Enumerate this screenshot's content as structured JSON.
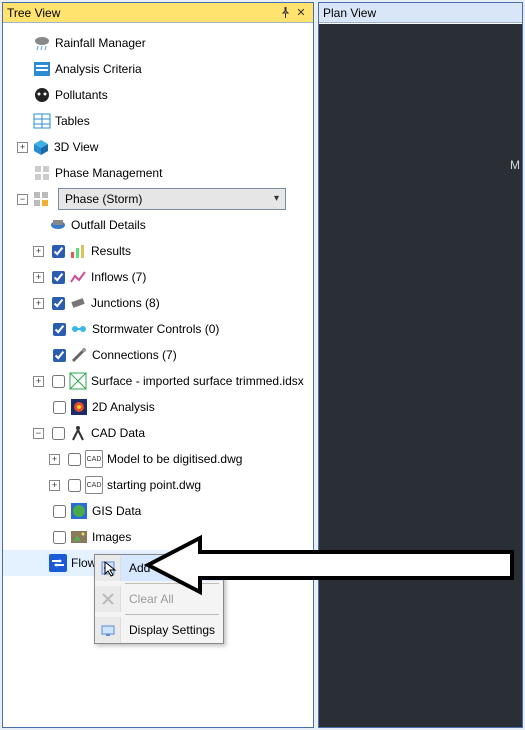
{
  "panels": {
    "tree": {
      "title": "Tree View"
    },
    "plan": {
      "title": "Plan View",
      "marker": "M"
    }
  },
  "tree": {
    "rainfall": "Rainfall Manager",
    "analysis_criteria": "Analysis Criteria",
    "pollutants": "Pollutants",
    "tables": "Tables",
    "view3d": "3D View",
    "phase_mgmt": "Phase Management",
    "phase_dd": "Phase (Storm)",
    "outfall": "Outfall Details",
    "results": "Results",
    "inflows": "Inflows (7)",
    "junctions": "Junctions (8)",
    "stormwater": "Stormwater Controls (0)",
    "connections": "Connections (7)",
    "surface": "Surface - imported surface trimmed.idsx",
    "analysis2d": "2D Analysis",
    "cad": "CAD Data",
    "cad_model": "Model to be digitised.dwg",
    "cad_start": "starting point.dwg",
    "gis": "GIS Data",
    "images": "Images",
    "flow": "Flow"
  },
  "context_menu": {
    "add": "Add",
    "clear": "Clear All",
    "display": "Display Settings"
  },
  "icons": {
    "pin": "📌",
    "close": "✕",
    "plus": "+",
    "minus": "−",
    "cad": "CAD"
  }
}
